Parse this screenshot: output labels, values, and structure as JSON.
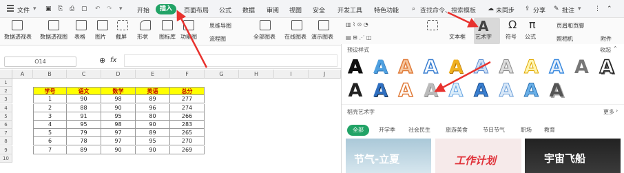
{
  "menubar": {
    "file": "文件",
    "tabs": [
      "开始",
      "插入",
      "页面布局",
      "公式",
      "数据",
      "审阅",
      "视图",
      "安全",
      "开发工具",
      "特色功能"
    ],
    "search_placeholder": "查找命令、搜索模板",
    "sync": "未同步",
    "share": "分享",
    "comment": "批注"
  },
  "ribbon": {
    "pivot_table": "数据透视表",
    "pivot_chart": "数据透视图",
    "table": "表格",
    "picture": "图片",
    "screenshot": "截屏",
    "shapes": "形状",
    "icon_lib": "图标库",
    "func_chart": "功能图",
    "flowchart": "流程图",
    "mindmap": "思维导图",
    "all_charts": "全部图表",
    "online_chart": "在线图表",
    "chart": "演示图表",
    "textbox": "文本框",
    "arttext": "艺术字",
    "symbol": "符号",
    "formula": "公式",
    "header_footer": "页眉和页脚",
    "camera": "照相机",
    "attachment": "附件",
    "art_label": "艺术字"
  },
  "formulabar": {
    "namebox": "O14",
    "fx": "fx",
    "formula": ""
  },
  "sheet": {
    "columns": [
      "A",
      "B",
      "C",
      "D",
      "E",
      "F",
      "G",
      "H",
      "I",
      "J"
    ],
    "rows": [
      "1",
      "2",
      "3",
      "4",
      "5",
      "6",
      "7",
      "8",
      "9",
      "10"
    ],
    "headers": [
      "学号",
      "语文",
      "数学",
      "英语",
      "总分"
    ],
    "data": [
      [
        "1",
        "90",
        "98",
        "89",
        "277"
      ],
      [
        "2",
        "88",
        "90",
        "96",
        "274"
      ],
      [
        "3",
        "91",
        "95",
        "80",
        "266"
      ],
      [
        "4",
        "95",
        "98",
        "90",
        "283"
      ],
      [
        "5",
        "79",
        "97",
        "89",
        "265"
      ],
      [
        "6",
        "78",
        "97",
        "95",
        "270"
      ],
      [
        "7",
        "89",
        "90",
        "90",
        "269"
      ]
    ]
  },
  "panel": {
    "preset_title": "预设样式",
    "collapse": "收起",
    "recommended_title": "稻壳艺术字",
    "more": "更多",
    "categories": [
      "全部",
      "开学季",
      "社会民生",
      "旅游美食",
      "节日节气",
      "职场",
      "教育"
    ],
    "thumbs": [
      "节气-立夏",
      "工作计划",
      "宇宙飞船"
    ]
  },
  "colors": {
    "accent": "#21a366",
    "arrow": "#e8322e",
    "header_fill": "#ffff00"
  }
}
